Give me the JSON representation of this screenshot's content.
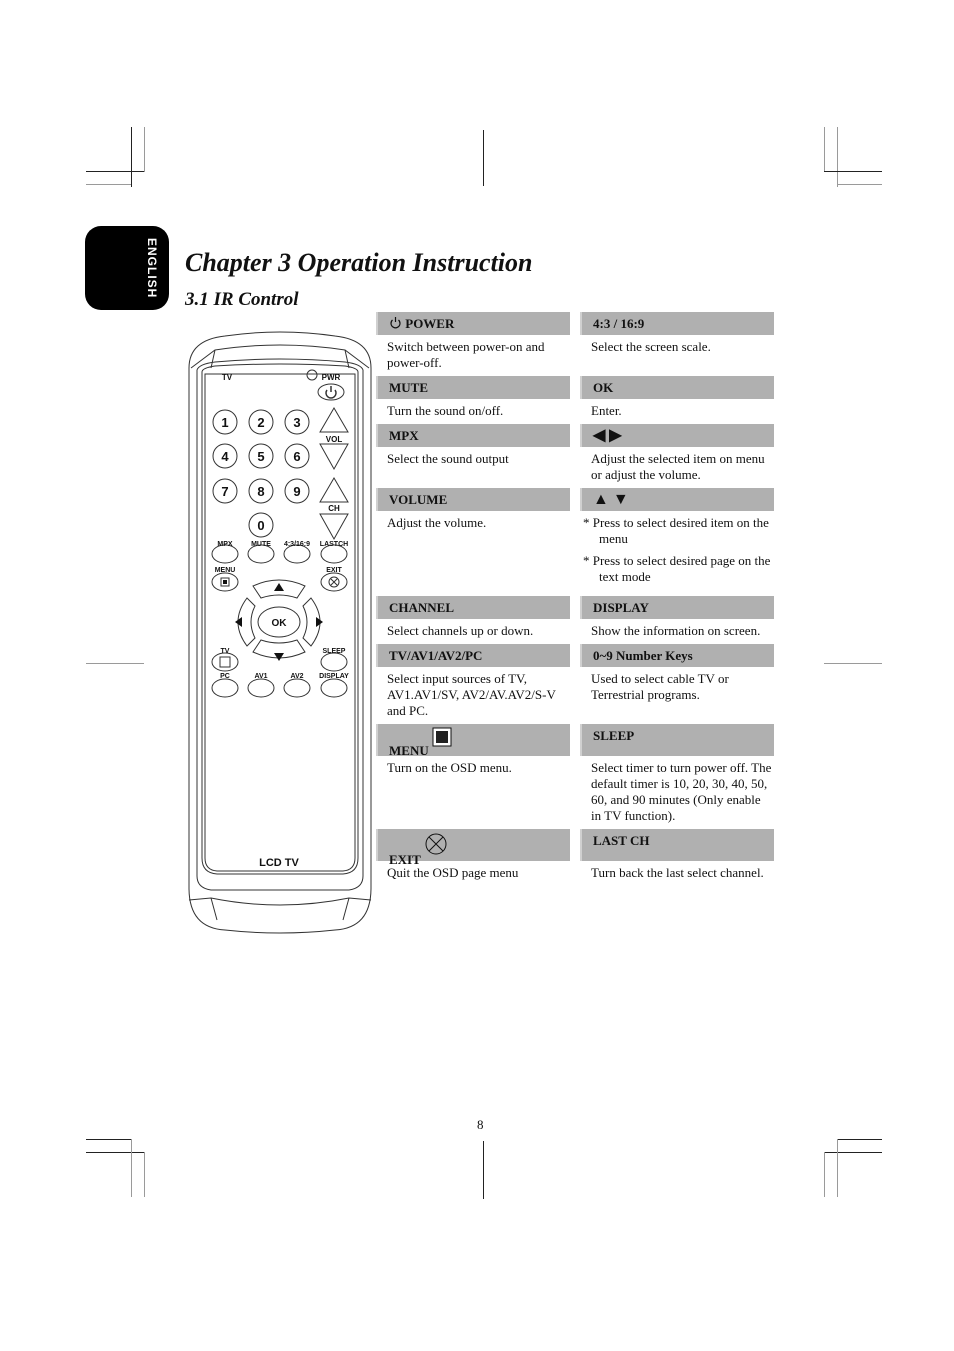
{
  "language_tab": "ENGLISH",
  "chapter_title": "Chapter 3 Operation Instruction",
  "section_title": "3.1 IR Control",
  "page_number": "8",
  "remote": {
    "labels": {
      "tv_top": "TV",
      "pwr": "PWR",
      "vol": "VOL",
      "ch": "CH",
      "mpx": "MPX",
      "mute": "MUTE",
      "scale": "4:3/16:9",
      "lastch": "LASTCH",
      "menu": "MENU",
      "exit": "EXIT",
      "ok": "OK",
      "tv": "TV",
      "sleep": "SLEEP",
      "pc": "PC",
      "av1": "AV1",
      "av2": "AV2",
      "display": "DISPLAY",
      "brand": "LCD TV"
    },
    "digits": [
      "1",
      "2",
      "3",
      "4",
      "5",
      "6",
      "7",
      "8",
      "9",
      "0"
    ]
  },
  "table": {
    "rows": [
      {
        "left_header": "POWER",
        "left_icon": "power-icon",
        "right_header": "4:3 / 16:9",
        "left_desc": "Switch between power-on and power-off.",
        "right_desc": "Select the screen scale."
      },
      {
        "left_header": "MUTE",
        "right_header": "OK",
        "left_desc": "Turn the sound on/off.",
        "right_desc": "Enter."
      },
      {
        "left_header": "MPX",
        "right_header": "◀  ▶",
        "right_icon": "left-right-arrows-icon",
        "left_desc": "Select the sound output",
        "right_desc": "Adjust the selected item on menu or adjust the volume."
      },
      {
        "left_header": "VOLUME",
        "right_header": "▲  ▼",
        "right_icon": "up-down-arrows-icon",
        "left_desc": "Adjust the volume.",
        "right_bullets": [
          "* Press to select desired item on the menu",
          "* Press to select desired page on the text mode"
        ]
      },
      {
        "left_header": "CHANNEL",
        "right_header": "DISPLAY",
        "left_desc": "Select channels up or down.",
        "right_desc": "Show the information on screen."
      },
      {
        "left_header": "TV/AV1/AV2/PC",
        "right_header": "0~9 Number Keys",
        "left_desc": "Select input sources of TV, AV1.AV1/SV, AV2/AV.AV2/S-V     and PC.",
        "right_desc": "Used to select cable TV or Terrestrial programs."
      },
      {
        "left_header": "MENU",
        "left_icon": "menu-square-icon",
        "right_header": "SLEEP",
        "left_desc": "Turn on the OSD menu.",
        "right_desc": "Select timer to turn power off. The default timer is 10, 20, 30, 40, 50, 60, and 90 minutes (Only enable in TV function)."
      },
      {
        "left_header": "EXIT",
        "left_icon": "exit-circle-x-icon",
        "right_header": "LAST CH",
        "left_desc": "Quit the OSD page menu",
        "right_desc": "Turn back the last select channel."
      }
    ]
  }
}
